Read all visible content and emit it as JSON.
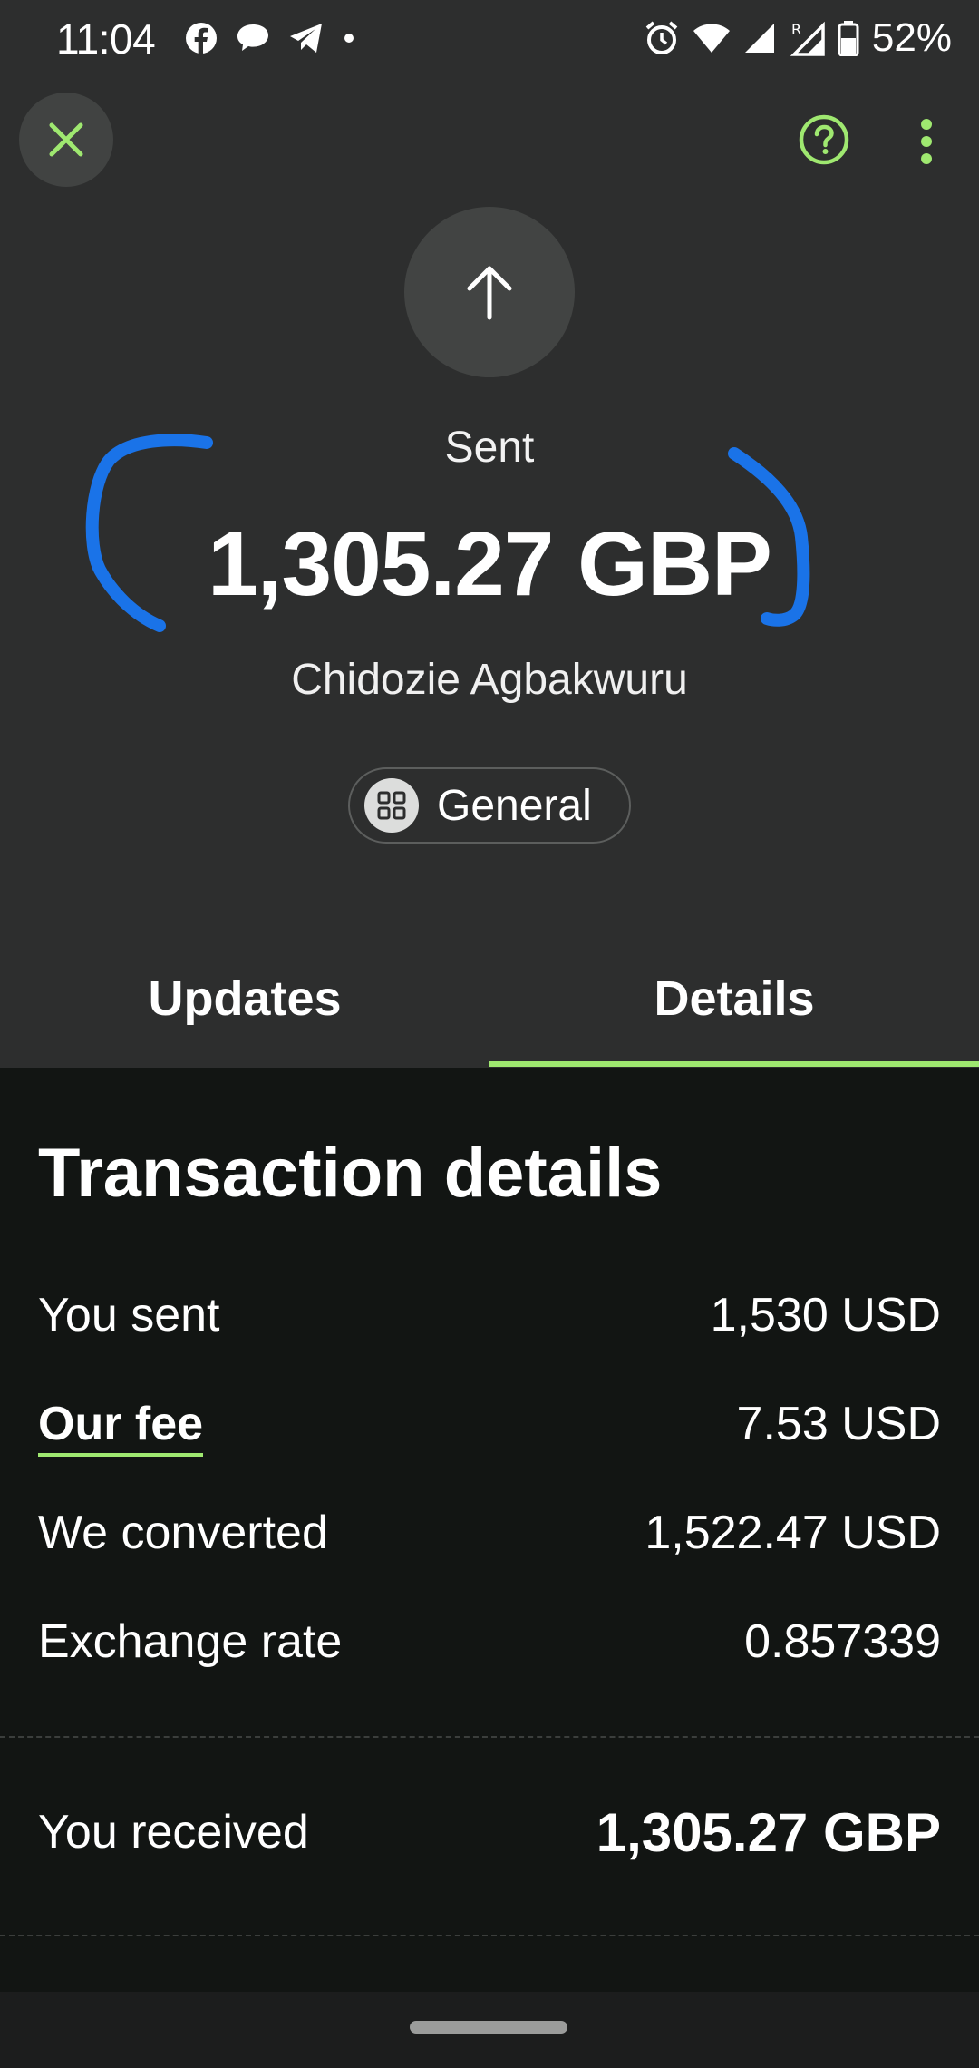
{
  "status_bar": {
    "time": "11:04",
    "battery": "52%",
    "icons": [
      "facebook-icon",
      "chat-bubble-icon",
      "telegram-icon",
      "dot-icon",
      "alarm-icon",
      "wifi-icon",
      "signal-icon",
      "signal-roaming-icon",
      "battery-icon"
    ]
  },
  "toolbar": {
    "close_icon": "close-icon",
    "help_icon": "help-icon",
    "more_icon": "more-vertical-icon",
    "accent_color": "#9fe870"
  },
  "header": {
    "direction_icon": "arrow-up-icon",
    "status": "Sent",
    "amount": "1,305.27 GBP",
    "recipient": "Chidozie Agbakwuru",
    "category_icon": "grid-icon",
    "category": "General"
  },
  "tabs": [
    {
      "label": "Updates",
      "selected": false
    },
    {
      "label": "Details",
      "selected": true
    }
  ],
  "details": {
    "title": "Transaction details",
    "rows": [
      {
        "label": "You sent",
        "value": "1,530 USD"
      },
      {
        "label": "Our fee",
        "value": "7.53 USD"
      },
      {
        "label": "We converted",
        "value": "1,522.47 USD"
      },
      {
        "label": "Exchange rate",
        "value": "0.857339"
      }
    ],
    "received": {
      "label": "You received",
      "value": "1,305.27 GBP"
    }
  },
  "annotation_color": "#1a73e8"
}
